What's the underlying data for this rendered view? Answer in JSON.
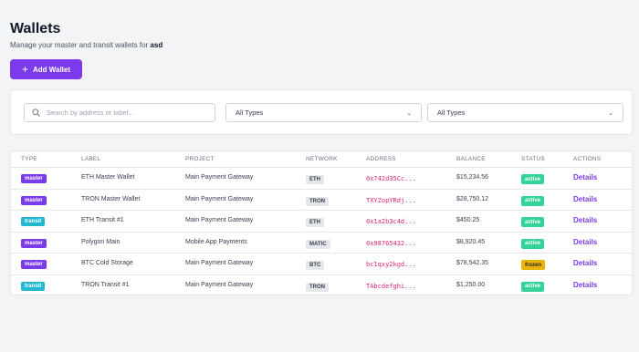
{
  "header": {
    "title": "Wallets",
    "subtitle_prefix": "Manage your master and transit wallets for",
    "subtitle_org": "asd",
    "add_button_label": "Add Wallet"
  },
  "filters": {
    "search_placeholder": "Search by address or label...",
    "type_filter_1": "All Types",
    "type_filter_2": "All Types"
  },
  "table": {
    "columns": [
      "TYPE",
      "LABEL",
      "PROJECT",
      "NETWORK",
      "ADDRESS",
      "BALANCE",
      "STATUS",
      "ACTIONS"
    ],
    "rows": [
      {
        "type": "master",
        "label": "ETH Master Wallet",
        "project": "Main Payment Gateway",
        "network": "ETH",
        "address": "0x742d35Cc...",
        "balance": "$15,234.56",
        "status": "active",
        "action": "Details"
      },
      {
        "type": "master",
        "label": "TRON Master Wallet",
        "project": "Main Payment Gateway",
        "network": "TRON",
        "address": "TXYZopYRdj...",
        "balance": "$28,750.12",
        "status": "active",
        "action": "Details"
      },
      {
        "type": "transit",
        "label": "ETH Transit #1",
        "project": "Main Payment Gateway",
        "network": "ETH",
        "address": "0x1a2b3c4d...",
        "balance": "$450.25",
        "status": "active",
        "action": "Details"
      },
      {
        "type": "master",
        "label": "Polygon Main",
        "project": "Mobile App Payments",
        "network": "MATIC",
        "address": "0x98765432...",
        "balance": "$8,920.45",
        "status": "active",
        "action": "Details"
      },
      {
        "type": "master",
        "label": "BTC Cold Storage",
        "project": "Main Payment Gateway",
        "network": "BTC",
        "address": "bc1qxy2kgd...",
        "balance": "$78,542.35",
        "status": "frozen",
        "action": "Details"
      },
      {
        "type": "transit",
        "label": "TRON Transit #1",
        "project": "Main Payment Gateway",
        "network": "TRON",
        "address": "TAbcdefghi...",
        "balance": "$1,250.00",
        "status": "active",
        "action": "Details"
      }
    ]
  },
  "colors": {
    "accent": "#7c3aed",
    "master": "#7c3aed",
    "transit": "#22b8cf",
    "active": "#34d399",
    "frozen": "#eab308",
    "address": "#db2777"
  },
  "icons": {
    "search": "search-icon",
    "plus": "plus-icon",
    "chevron": "chevron-down-icon"
  }
}
